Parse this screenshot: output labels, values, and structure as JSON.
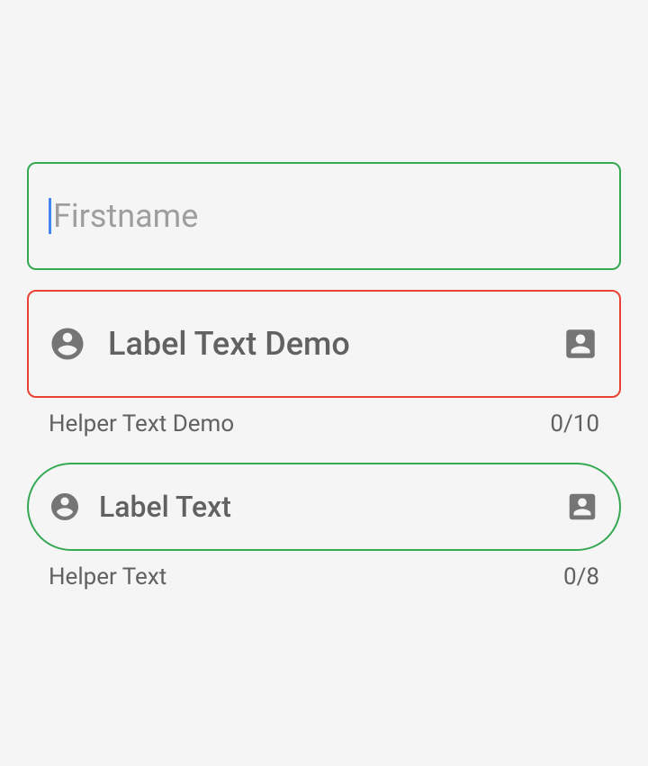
{
  "fields": [
    {
      "placeholder": "Firstname",
      "has_cursor": true
    },
    {
      "label": "Label Text Demo",
      "helper": "Helper Text Demo",
      "counter": "0/10"
    },
    {
      "label": "Label Text",
      "helper": "Helper Text",
      "counter": "0/8"
    }
  ]
}
